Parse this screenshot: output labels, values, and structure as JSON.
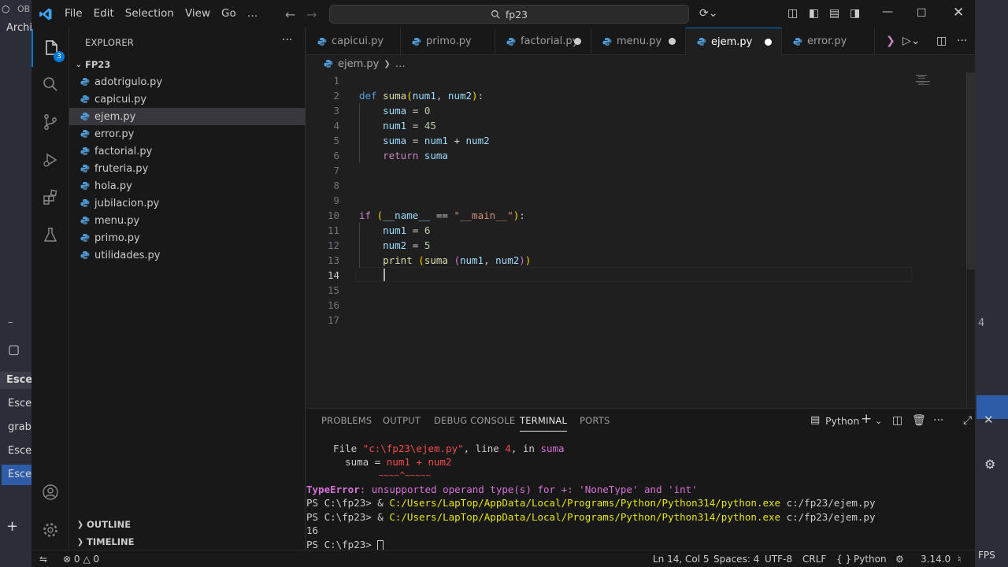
{
  "background_app": {
    "top_left": "OB",
    "archive_label": "Archiv",
    "scenes_header": "Escen",
    "scenes": [
      "Escen",
      "graba",
      "Escen",
      "Escen"
    ],
    "fps_label": "FPS",
    "number_4": "4"
  },
  "titlebar": {
    "menu": [
      "File",
      "Edit",
      "Selection",
      "View",
      "Go",
      "…"
    ],
    "search_text": "fp23"
  },
  "activity_bar": {
    "explorer_badge": "3"
  },
  "sidebar": {
    "title": "EXPLORER",
    "more": "···",
    "folder": "FP23",
    "files": [
      "adotrigulo.py",
      "capicui.py",
      "ejem.py",
      "error.py",
      "factorial.py",
      "fruteria.py",
      "hola.py",
      "jubilacion.py",
      "menu.py",
      "primo.py",
      "utilidades.py"
    ],
    "selected_file": "ejem.py",
    "outline": "OUTLINE",
    "timeline": "TIMELINE"
  },
  "tabs": [
    {
      "label": "capicui.py",
      "modified": false
    },
    {
      "label": "primo.py",
      "modified": false
    },
    {
      "label": "factorial.py",
      "modified": true
    },
    {
      "label": "menu.py",
      "modified": true
    },
    {
      "label": "ejem.py",
      "modified": true,
      "active": true
    },
    {
      "label": "error.py",
      "modified": false
    }
  ],
  "breadcrumb": {
    "file": "ejem.py",
    "more": "…"
  },
  "editor": {
    "line_numbers": [
      "1",
      "2",
      "3",
      "4",
      "5",
      "6",
      "7",
      "8",
      "9",
      "10",
      "11",
      "12",
      "13",
      "14",
      "15",
      "16",
      "17"
    ],
    "current_line": 14
  },
  "panel": {
    "tabs": [
      "PROBLEMS",
      "OUTPUT",
      "DEBUG CONSOLE",
      "TERMINAL",
      "PORTS"
    ],
    "active_tab": "TERMINAL",
    "shell": "Python",
    "terminal": {
      "l1_a": "  File ",
      "l1_b": "\"c:\\fp23\\ejem.py\"",
      "l1_c": ", line ",
      "l1_d": "4",
      "l1_e": ", in ",
      "l1_f": "suma",
      "l2_a": "    suma = ",
      "l2_b": "num1 + num2",
      "l3": "           ~~~~^~~~~~",
      "l4_a": "TypeError",
      "l4_b": ": unsupported operand type(s) for +: 'NoneType' and 'int'",
      "l5_a": "PS C:\\fp23> & ",
      "l5_b": "C:/Users/LapTop/AppData/Local/Programs/Python/Python314/python.exe",
      "l5_c": " c:/fp23/ejem.py",
      "l6_a": "PS C:\\fp23> & ",
      "l6_b": "C:/Users/LapTop/AppData/Local/Programs/Python/Python314/python.exe",
      "l6_c": " c:/fp23/ejem.py",
      "l7": "16",
      "l8": "PS C:\\fp23> "
    }
  },
  "statusbar": {
    "errors": "0",
    "warnings": "0",
    "position": "Ln 14, Col 5",
    "spaces": "Spaces: 4",
    "encoding": "UTF-8",
    "eol": "CRLF",
    "language_braces": "{ }",
    "language": "Python",
    "version": "3.14.0"
  },
  "colors": {
    "accent": "#0078d4",
    "editor_bg": "#1f1f1f",
    "chrome_bg": "#181818"
  }
}
